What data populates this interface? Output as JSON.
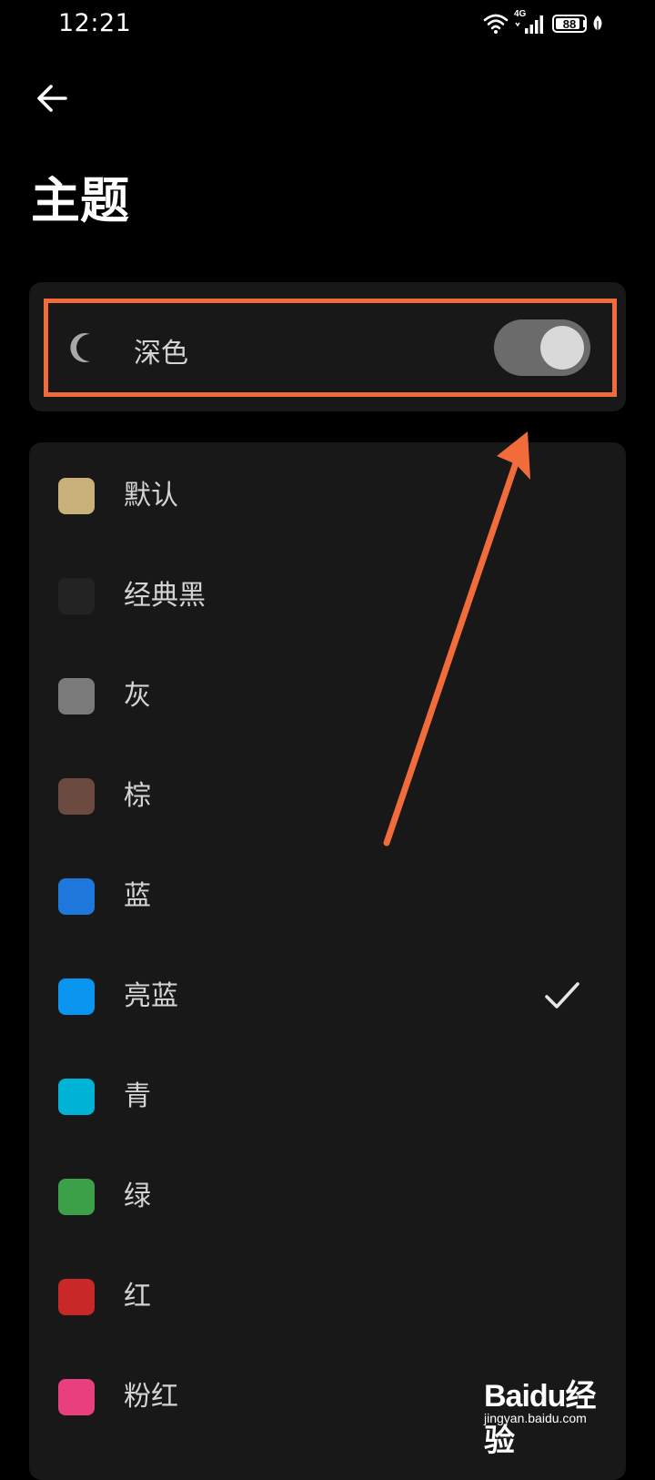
{
  "status_bar": {
    "time": "12:21",
    "network": "4G",
    "battery_level": "88",
    "battery_fraction": 0.88,
    "icons": [
      "wifi-icon",
      "signal-icon",
      "battery-icon",
      "leaf-icon"
    ]
  },
  "header": {
    "back_icon": "arrow-left-icon",
    "title": "主题"
  },
  "dark_mode": {
    "icon": "moon-icon",
    "label": "深色",
    "enabled": true
  },
  "themes": {
    "selected": "亮蓝",
    "items": [
      {
        "label": "默认",
        "color": "#c8b27a"
      },
      {
        "label": "经典黑",
        "color": "#232323"
      },
      {
        "label": "灰",
        "color": "#7a7a7a"
      },
      {
        "label": "棕",
        "color": "#6b4a40"
      },
      {
        "label": "蓝",
        "color": "#1e78dc"
      },
      {
        "label": "亮蓝",
        "color": "#0a96f0"
      },
      {
        "label": "青",
        "color": "#00b4d8"
      },
      {
        "label": "绿",
        "color": "#3ca048"
      },
      {
        "label": "红",
        "color": "#c82828"
      },
      {
        "label": "粉红",
        "color": "#e8407e"
      }
    ]
  },
  "annotation": {
    "highlight_color": "#f26b3a"
  },
  "watermark": {
    "logo": "Baidu经验",
    "url": "jingyan.baidu.com"
  }
}
